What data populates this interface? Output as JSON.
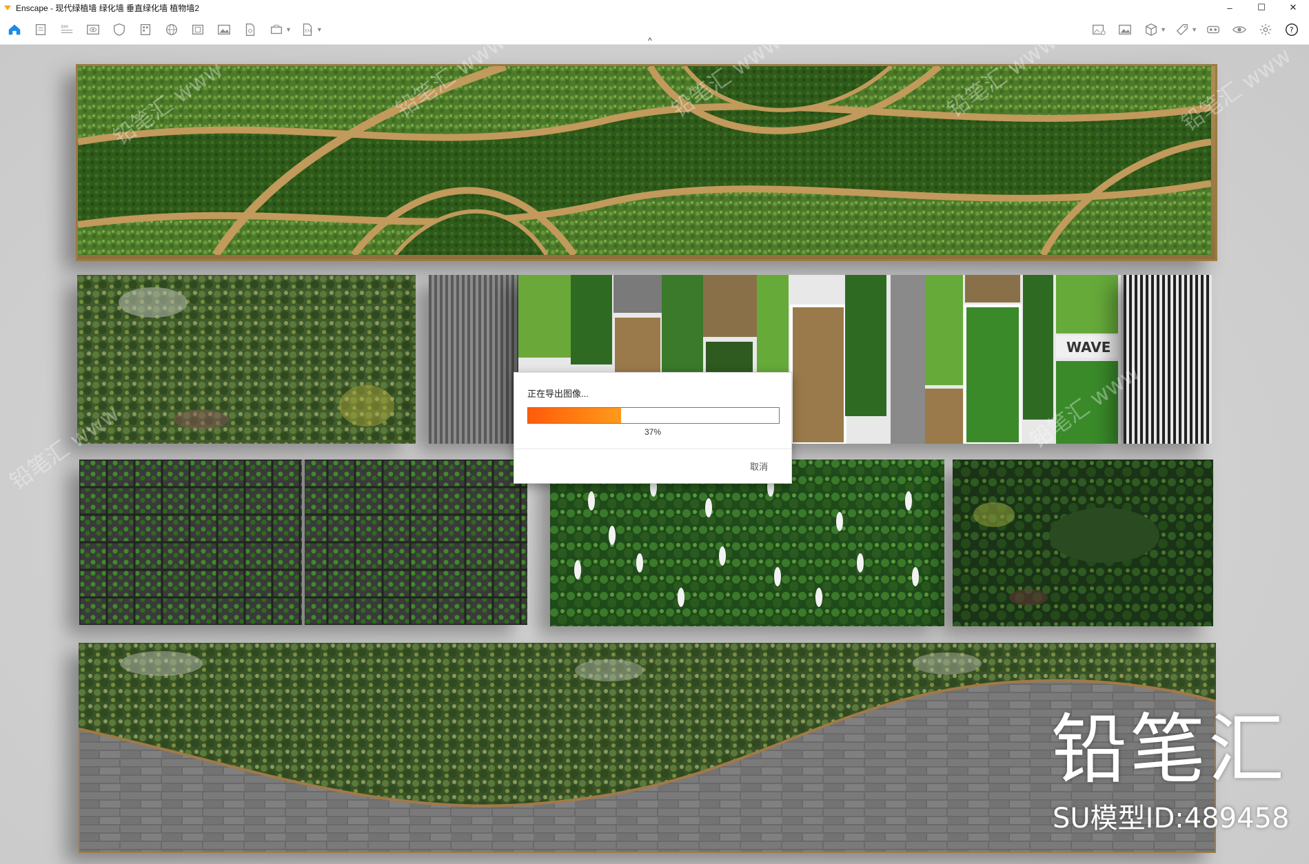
{
  "window": {
    "title": "Enscape - 现代绿植墙 绿化墙 垂直绿化墙 植物墙2",
    "controls": [
      "–",
      "☐",
      "✕"
    ]
  },
  "toolbar": {
    "left_icons": [
      "home-icon",
      "document-icon",
      "bim-icon",
      "eye-box-icon",
      "shield-icon",
      "building-icon",
      "globe-icon",
      "frame-icon",
      "image-icon",
      "file-image-icon",
      "batch-icon",
      "export-icon"
    ],
    "right_icons": [
      "image-add-icon",
      "gallery-icon",
      "cube-icon",
      "tag-icon",
      "vr-icon",
      "visibility-icon",
      "settings-icon",
      "help-icon"
    ],
    "collapse_symbol": "^"
  },
  "viewport": {
    "wave_wall_label": "WAVE",
    "brand_text": "铅笔汇",
    "model_id": "SU模型ID:489458",
    "watermark": "铅笔汇 www"
  },
  "export_dialog": {
    "title": "正在导出图像...",
    "progress": 37,
    "progress_text": "37%",
    "cancel_label": "取消"
  }
}
